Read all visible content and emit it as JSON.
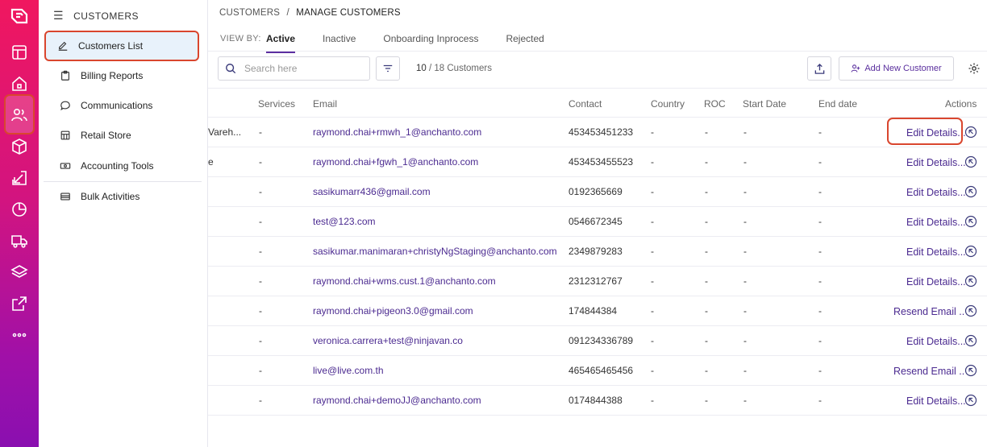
{
  "sidebar": {
    "header": "CUSTOMERS",
    "items": [
      {
        "label": "Customers List",
        "icon": "pencil-icon",
        "active": true
      },
      {
        "label": "Billing Reports",
        "icon": "clipboard-icon"
      },
      {
        "label": "Communications",
        "icon": "chat-bubble-icon"
      },
      {
        "label": "Retail Store",
        "icon": "store-icon"
      },
      {
        "label": "Accounting Tools",
        "icon": "money-icon"
      },
      {
        "label": "Bulk Activities",
        "icon": "stack-icon"
      }
    ]
  },
  "breadcrumb": {
    "root": "CUSTOMERS",
    "separator": "/",
    "current": "MANAGE CUSTOMERS"
  },
  "viewby": {
    "label": "VIEW BY:",
    "tabs": [
      "Active",
      "Inactive",
      "Onboarding Inprocess",
      "Rejected"
    ],
    "active": "Active"
  },
  "toolbar": {
    "search_placeholder": "Search here",
    "count_shown": "10",
    "count_total": "/ 18 Customers",
    "add_label": "Add New Customer"
  },
  "table": {
    "headers": {
      "services": "Services",
      "email": "Email",
      "contact": "Contact",
      "country": "Country",
      "roc": "ROC",
      "start": "Start Date",
      "end": "End date",
      "actions": "Actions"
    },
    "rows": [
      {
        "name": "Vareh...",
        "services": "-",
        "email": "raymond.chai+rmwh_1@anchanto.com",
        "contact": "453453451233",
        "country": "-",
        "roc": "-",
        "start": "-",
        "end": "-",
        "action": "Edit Details..."
      },
      {
        "name": "e",
        "services": "-",
        "email": "raymond.chai+fgwh_1@anchanto.com",
        "contact": "453453455523",
        "country": "-",
        "roc": "-",
        "start": "-",
        "end": "-",
        "action": "Edit Details..."
      },
      {
        "name": "",
        "services": "-",
        "email": "sasikumarr436@gmail.com",
        "contact": "0192365669",
        "country": "-",
        "roc": "-",
        "start": "-",
        "end": "-",
        "action": "Edit Details..."
      },
      {
        "name": "",
        "services": "-",
        "email": "test@123.com",
        "contact": "0546672345",
        "country": "-",
        "roc": "-",
        "start": "-",
        "end": "-",
        "action": "Edit Details..."
      },
      {
        "name": "",
        "services": "-",
        "email": "sasikumar.manimaran+christyNgStaging@anchanto.com",
        "contact": "2349879283",
        "country": "-",
        "roc": "-",
        "start": "-",
        "end": "-",
        "action": "Edit Details..."
      },
      {
        "name": "",
        "services": "-",
        "email": "raymond.chai+wms.cust.1@anchanto.com",
        "contact": "2312312767",
        "country": "-",
        "roc": "-",
        "start": "-",
        "end": "-",
        "action": "Edit Details..."
      },
      {
        "name": "",
        "services": "-",
        "email": "raymond.chai+pigeon3.0@gmail.com",
        "contact": "174844384",
        "country": "-",
        "roc": "-",
        "start": "-",
        "end": "-",
        "action": "Resend Email .."
      },
      {
        "name": "",
        "services": "-",
        "email": "veronica.carrera+test@ninjavan.co",
        "contact": "091234336789",
        "country": "-",
        "roc": "-",
        "start": "-",
        "end": "-",
        "action": "Edit Details..."
      },
      {
        "name": "",
        "services": "-",
        "email": "live@live.com.th",
        "contact": "465465465456",
        "country": "-",
        "roc": "-",
        "start": "-",
        "end": "-",
        "action": "Resend Email .."
      },
      {
        "name": "",
        "services": "-",
        "email": "raymond.chai+demoJJ@anchanto.com",
        "contact": "0174844388",
        "country": "-",
        "roc": "-",
        "start": "-",
        "end": "-",
        "action": "Edit Details..."
      }
    ]
  },
  "colors": {
    "accent": "#5c2fa0",
    "highlight": "#d9462e",
    "rail_top": "#f0175f",
    "rail_bottom": "#8a0fb0"
  }
}
